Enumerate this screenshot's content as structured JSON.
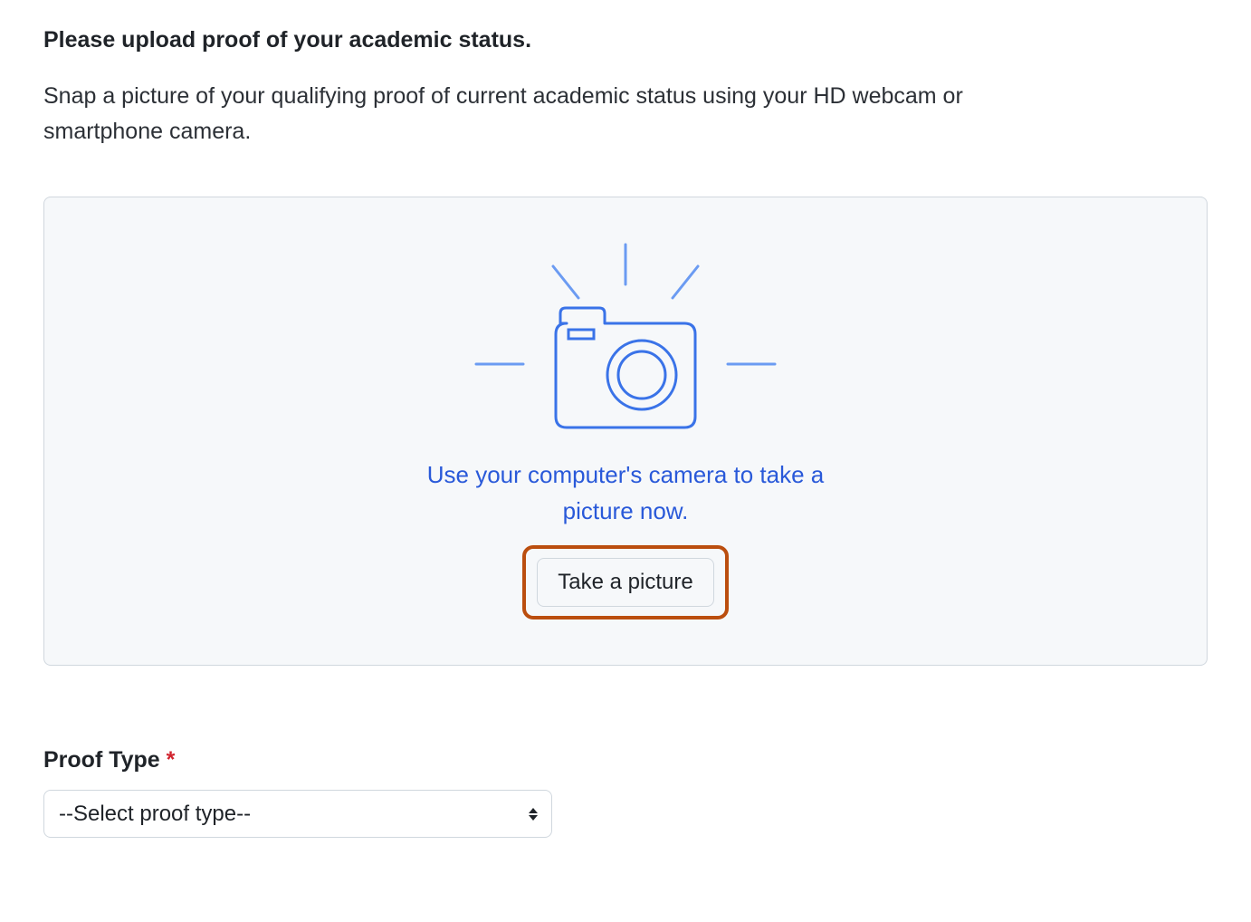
{
  "heading": "Please upload proof of your academic status.",
  "description": "Snap a picture of your qualifying proof of current academic status using your HD webcam or smartphone camera.",
  "upload_panel": {
    "camera_prompt": "Use your computer's camera to take a picture now.",
    "take_picture_label": "Take a picture"
  },
  "proof_type": {
    "label": "Proof Type",
    "required_mark": "*",
    "selected": "--Select proof type--"
  },
  "colors": {
    "panel_bg": "#f6f8fa",
    "panel_border": "#d0d7de",
    "link_blue": "#2959d9",
    "highlight_orange": "#bb4e0e",
    "required_red": "#d1242f"
  }
}
